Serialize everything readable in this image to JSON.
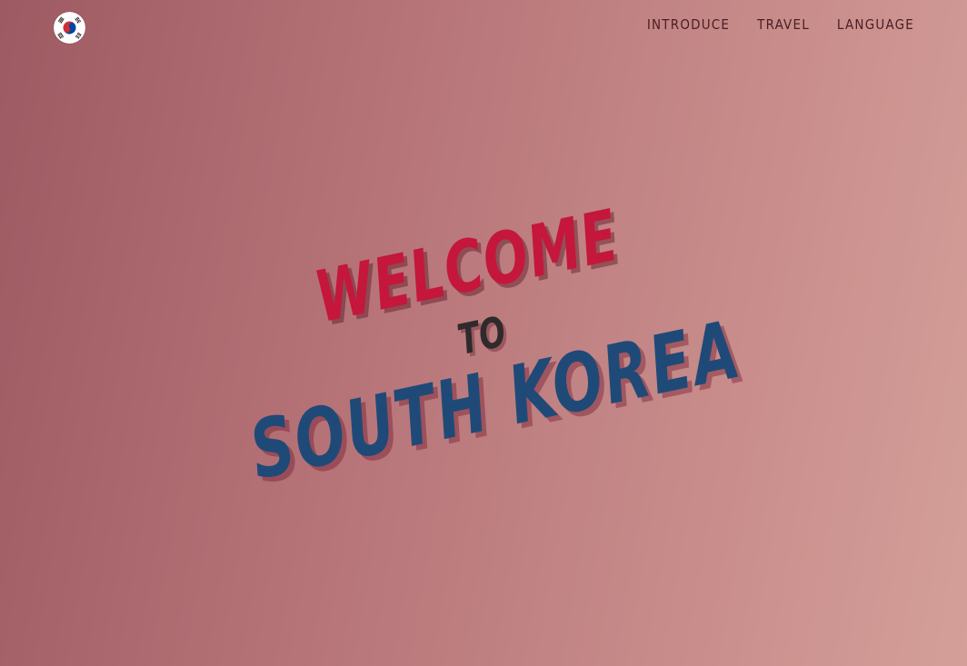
{
  "header": {
    "logo_icon": "south-korea-flag-icon",
    "nav": [
      {
        "label": "INTRODUCE"
      },
      {
        "label": "TRAVEL"
      },
      {
        "label": "LANGUAGE"
      }
    ]
  },
  "hero": {
    "line1": "WELCOME",
    "line2": "TO",
    "line3": "SOUTH KOREA"
  },
  "colors": {
    "welcome": "#c4173b",
    "to": "#2f2a2c",
    "korea": "#1f4a78",
    "nav_text": "#4a1e24",
    "background_left": "#9e5a62",
    "background_right": "#d49f99"
  }
}
